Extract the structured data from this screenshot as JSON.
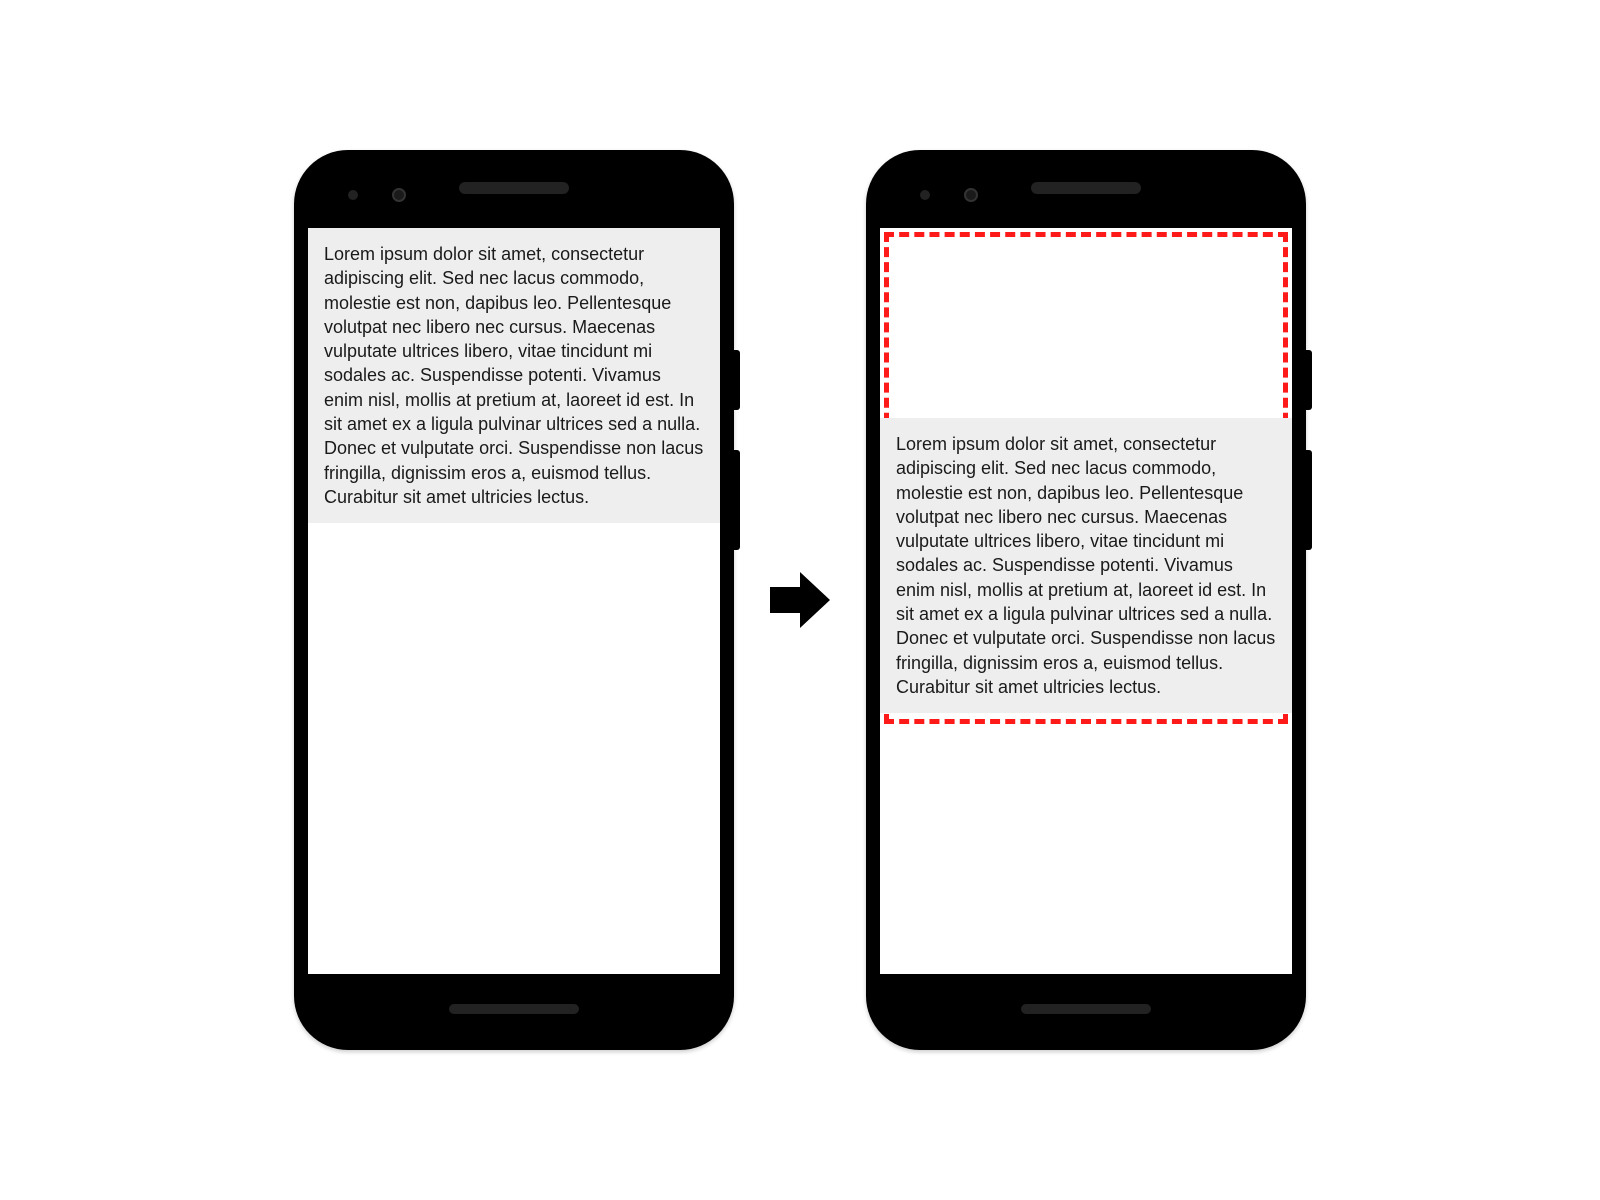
{
  "lorem_text": "Lorem ipsum dolor sit amet, consectetur adipiscing elit. Sed nec lacus commodo, molestie est non, dapibus leo. Pellentesque volutpat nec libero nec cursus. Maecenas vulputate ultrices libero, vitae tincidunt mi sodales ac. Suspendisse potenti. Vivamus enim nisl, mollis at pretium at, laoreet id est. In sit amet ex a ligula pulvinar ultrices sed a nulla. Donec et vulputate orci. Suspendisse non lacus fringilla, dignissim eros a, euismod tellus. Curabitur sit amet ultricies lectus.",
  "colors": {
    "highlight": "#ff1a1a",
    "text_bg": "#eeeeee",
    "frame": "#000000"
  }
}
